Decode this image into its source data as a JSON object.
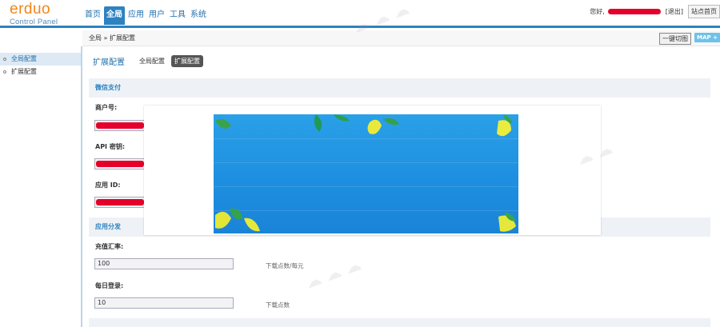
{
  "header": {
    "logo_main": "erduo",
    "logo_sub": "Control Panel",
    "nav": [
      "首页",
      "全局",
      "应用",
      "用户",
      "工具",
      "系统"
    ],
    "active_nav_index": 1,
    "greeting": "您好,",
    "logout": "[退出]",
    "site_home": "站点首页"
  },
  "subbar": {
    "breadcrumb": "全局 » 扩展配置",
    "clear_cache": "一键切图",
    "map": "MAP"
  },
  "sidebar": {
    "items": [
      {
        "label": "全局配置",
        "active": true
      },
      {
        "label": "扩展配置",
        "active": false
      }
    ]
  },
  "main": {
    "title": "扩展配置",
    "tabs": [
      {
        "label": "全局配置",
        "active": false
      },
      {
        "label": "扩展配置",
        "active": true
      }
    ],
    "sections": [
      {
        "title": "微信支付",
        "fields": [
          {
            "label": "商户号:"
          },
          {
            "label": "API 密钥:"
          },
          {
            "label": "应用 ID:"
          }
        ]
      },
      {
        "title": "应用分发",
        "fields": [
          {
            "label": "充值汇率:",
            "value": "100",
            "hint": "下载点数/每元"
          },
          {
            "label": "每日登录:",
            "value": "10",
            "hint": "下载点数"
          }
        ]
      }
    ]
  },
  "colors": {
    "accent": "#2d82c0",
    "logo_orange": "#f08519",
    "redaction": "#e4002b"
  }
}
